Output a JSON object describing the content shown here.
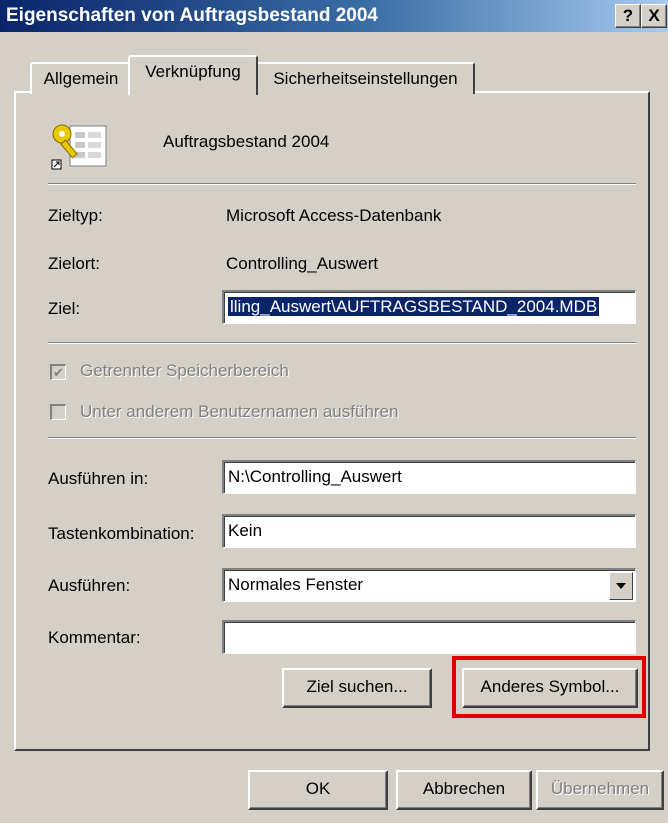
{
  "window": {
    "title": "Eigenschaften von Auftragsbestand 2004",
    "help_label": "?",
    "close_label": "X"
  },
  "tabs": [
    {
      "label": "Allgemein"
    },
    {
      "label": "Verknüpfung"
    },
    {
      "label": "Sicherheitseinstellungen"
    }
  ],
  "shortcut": {
    "name": "Auftragsbestand 2004",
    "icon": "access-database-shortcut-icon"
  },
  "fields": {
    "zieltyp_label": "Zieltyp:",
    "zieltyp_value": "Microsoft Access-Datenbank",
    "zielort_label": "Zielort:",
    "zielort_value": "Controlling_Auswert",
    "ziel_label": "Ziel:",
    "ziel_value": "lling_Auswert\\AUFTRAGSBESTAND_2004.MDB",
    "separate_memory_label": "Getrennter Speicherbereich",
    "run_as_label": "Unter anderem Benutzernamen ausführen",
    "start_in_label": "Ausführen in:",
    "start_in_value": "N:\\Controlling_Auswert",
    "hotkey_label": "Tastenkombination:",
    "hotkey_value": "Kein",
    "run_label": "Ausführen:",
    "run_value": "Normales Fenster",
    "comment_label": "Kommentar:",
    "comment_value": ""
  },
  "buttons": {
    "find_target": "Ziel suchen...",
    "change_icon": "Anderes Symbol...",
    "ok": "OK",
    "cancel": "Abbrechen",
    "apply": "Übernehmen"
  },
  "colors": {
    "highlight": "#e00000",
    "title_bar": "#0a246a"
  }
}
